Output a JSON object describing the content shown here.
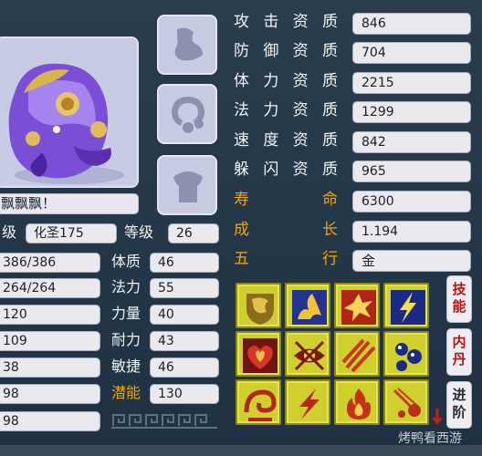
{
  "pet": {
    "name": "飘飘飘！"
  },
  "info_rows": [
    {
      "label": "级",
      "value": "化圣175",
      "label2": "等级",
      "value2": "26"
    },
    {
      "value": "386/386",
      "label2": "体质",
      "value2": "46"
    },
    {
      "value": "264/264",
      "label2": "法力",
      "value2": "55"
    },
    {
      "value": "120",
      "label2": "力量",
      "value2": "40"
    },
    {
      "value": "109",
      "label2": "耐力",
      "value2": "43"
    },
    {
      "value": "38",
      "label2": "敏捷",
      "value2": "46"
    },
    {
      "value": "98",
      "label2": "潜能",
      "value2": "130"
    },
    {
      "value": "98"
    }
  ],
  "aptitudes": [
    {
      "chars": [
        "攻",
        "击",
        "资",
        "质"
      ],
      "value": "846"
    },
    {
      "chars": [
        "防",
        "御",
        "资",
        "质"
      ],
      "value": "704"
    },
    {
      "chars": [
        "体",
        "力",
        "资",
        "质"
      ],
      "value": "2215"
    },
    {
      "chars": [
        "法",
        "力",
        "资",
        "质"
      ],
      "value": "1299"
    },
    {
      "chars": [
        "速",
        "度",
        "资",
        "质"
      ],
      "value": "842"
    },
    {
      "chars": [
        "躲",
        "闪",
        "资",
        "质"
      ],
      "value": "965"
    },
    {
      "chars": [
        "寿",
        "命"
      ],
      "value": "6300"
    },
    {
      "chars": [
        "成",
        "长"
      ],
      "value": "1.194"
    },
    {
      "chars": [
        "五",
        "行"
      ],
      "value": "金"
    }
  ],
  "side_buttons": {
    "skills": [
      "技",
      "能"
    ],
    "inner_core": [
      "内",
      "丹"
    ],
    "advance": [
      "进",
      "阶"
    ]
  },
  "skills": [
    "shield-swirl-icon",
    "flame-wave-icon",
    "explosion-icon",
    "lightning-icon",
    "heart-flame-icon",
    "eye-sigil-icon",
    "triple-slash-icon",
    "orbs-icon",
    "wind-swirl-icon",
    "lightning-bolt-icon",
    "fire-icon",
    "meteor-icon"
  ],
  "watermark": "烤鸭看西游",
  "colors": {
    "gold_label": "#f0a20d",
    "panel": "#2a3d4f",
    "skill_bg": "#cfcf2e"
  }
}
